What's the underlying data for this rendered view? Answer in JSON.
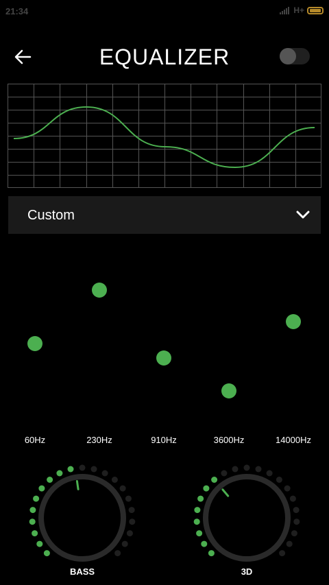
{
  "status_bar": {
    "time": "21:34",
    "network": "H+"
  },
  "header": {
    "title": "EQUALIZER",
    "enabled": false
  },
  "preset": {
    "selected": "Custom"
  },
  "bands": [
    {
      "label": "60Hz",
      "level": 0.45
    },
    {
      "label": "230Hz",
      "level": 0.82
    },
    {
      "label": "910Hz",
      "level": 0.35
    },
    {
      "label": "3600Hz",
      "level": 0.12
    },
    {
      "label": "14000Hz",
      "level": 0.6
    }
  ],
  "knobs": [
    {
      "label": "BASS",
      "level_fraction": 0.47
    },
    {
      "label": "3D",
      "level_fraction": 0.35
    }
  ],
  "colors": {
    "accent": "#4caf50",
    "grid": "#555555",
    "panel": "#1a1a1a",
    "dot_inactive": "#1f1f1f"
  }
}
